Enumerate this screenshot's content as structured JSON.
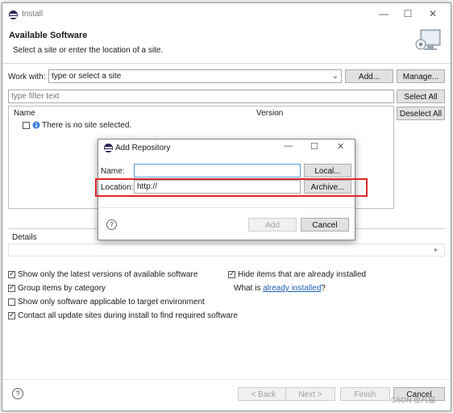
{
  "window": {
    "title": "Install",
    "header_title": "Available Software",
    "header_subtitle": "Select a site or enter the location of a site."
  },
  "work_with": {
    "label": "Work with:",
    "value": "type or select a site",
    "add_label": "Add...",
    "manage_label": "Manage..."
  },
  "filter": {
    "placeholder": "type filter text",
    "select_all": "Select All",
    "deselect_all": "Deselect All"
  },
  "table": {
    "columns": [
      "Name",
      "Version"
    ],
    "empty_message": "There is no site selected."
  },
  "details_label": "Details",
  "options": {
    "latest_versions": "Show only the latest versions of available software",
    "group_by_category": "Group items by category",
    "applicable_only": "Show only software applicable to target environment",
    "contact_sites": "Contact all update sites during install to find required software",
    "hide_installed": "Hide items that are already installed",
    "what_is": "What is ",
    "already_installed_link": "already installed",
    "question_mark": "?"
  },
  "footer": {
    "back": "< Back",
    "next": "Next >",
    "finish": "Finish",
    "cancel": "Cancel",
    "watermark": "CSDN @凡猫"
  },
  "dialog": {
    "title": "Add Repository",
    "name_label": "Name:",
    "name_value": "",
    "local_label": "Local...",
    "location_label": "Location:",
    "location_value": "http://",
    "archive_label": "Archive...",
    "add_label": "Add",
    "cancel_label": "Cancel"
  },
  "colors": {
    "highlight": "#e0262b",
    "link": "#1a5fb4",
    "eclipse": "#2c2255"
  }
}
